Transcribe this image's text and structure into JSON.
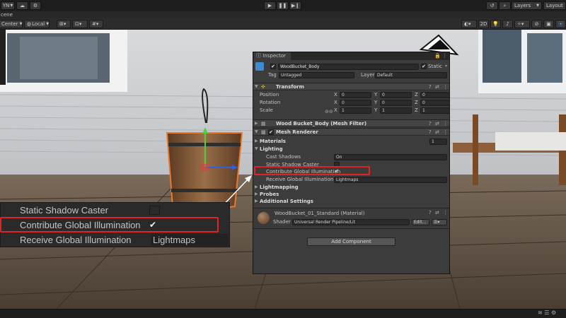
{
  "toolbar": {
    "account": "YN",
    "layers": "Layers",
    "layout": "Layout"
  },
  "scene": {
    "tab": "cene",
    "pivot": "Center",
    "space": "Local",
    "mode_2d": "2D"
  },
  "inspector": {
    "tab": "Inspector",
    "object": {
      "name": "WoodBucket_Body",
      "static": "Static",
      "tag_label": "Tag",
      "tag": "Untagged",
      "layer_label": "Layer",
      "layer": "Default"
    },
    "transform": {
      "title": "Transform",
      "rows": [
        {
          "label": "Position",
          "x": "0",
          "y": "0",
          "z": "0"
        },
        {
          "label": "Rotation",
          "x": "0",
          "y": "0",
          "z": "0"
        },
        {
          "label": "Scale",
          "x": "1",
          "y": "1",
          "z": "1"
        }
      ],
      "axis_x": "X",
      "axis_y": "Y",
      "axis_z": "Z"
    },
    "mesh_filter": {
      "title": "Wood Bucket_Body (Mesh Filter)"
    },
    "mesh_renderer": {
      "title": "Mesh Renderer"
    },
    "materials": {
      "label": "Materials",
      "count": "1"
    },
    "lighting": {
      "label": "Lighting",
      "cast_shadows_label": "Cast Shadows",
      "cast_shadows": "On",
      "static_shadow_caster": "Static Shadow Caster",
      "contribute_gi": "Contribute Global Illumination",
      "receive_gi_label": "Receive Global Illumination",
      "receive_gi": "Lightmaps"
    },
    "lightmapping": "Lightmapping",
    "probes": "Probes",
    "additional": "Additional Settings",
    "material": {
      "name": "WoodBucket_01_Standard (Material)",
      "shader_label": "Shader",
      "shader": "Universal Render Pipeline/Lit",
      "edit": "Edit..."
    },
    "add_component": "Add Component"
  },
  "zoom": {
    "static_shadow_caster": "Static Shadow Caster",
    "contribute_gi": "Contribute Global Illumination",
    "receive_gi": "Receive Global Illumination",
    "receive_value": "Lightmaps"
  },
  "check_glyph": "✔"
}
